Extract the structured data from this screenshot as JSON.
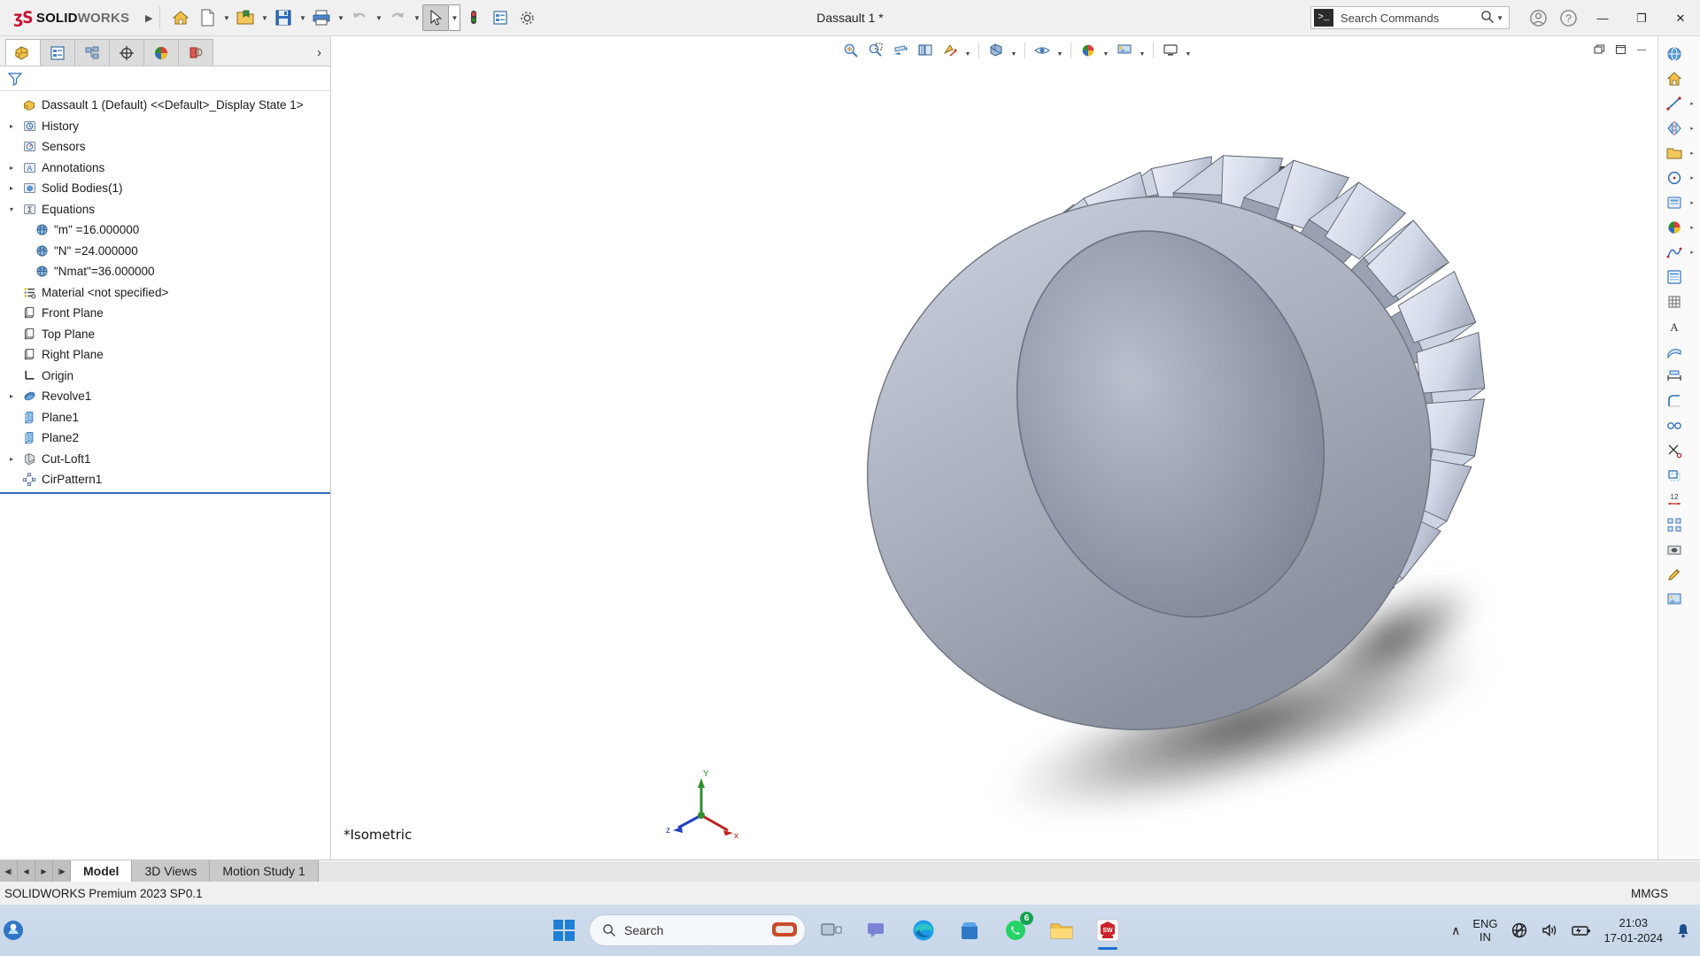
{
  "app": {
    "brand_ds": "ʒS",
    "brand_solid": "SOLID",
    "brand_works": "WORKS",
    "title": "Dassault 1 *",
    "accent_red": "#c8102e"
  },
  "titlebar": {
    "menu_arrow": "▶",
    "buttons": [
      {
        "name": "home-button",
        "icon": "home-icon"
      },
      {
        "name": "new-document-button",
        "icon": "new-file-icon"
      },
      {
        "name": "open-document-button",
        "icon": "open-folder-icon"
      },
      {
        "name": "save-button",
        "icon": "save-disk-icon"
      },
      {
        "name": "print-button",
        "icon": "printer-icon"
      },
      {
        "name": "undo-button",
        "icon": "undo-arrow-icon"
      },
      {
        "name": "redo-button",
        "icon": "redo-arrow-icon"
      },
      {
        "name": "select-button",
        "icon": "cursor-arrow-icon"
      },
      {
        "name": "rebuild-button",
        "icon": "traffic-light-icon"
      },
      {
        "name": "options-list-button",
        "icon": "list-properties-icon"
      },
      {
        "name": "settings-button",
        "icon": "gear-icon"
      }
    ],
    "search_placeholder": "Search Commands",
    "search_prompt_glyph": ">_",
    "window_min": "—",
    "window_max": "❐",
    "window_close": "✕"
  },
  "feature_manager": {
    "tabs": [
      {
        "name": "feature-manager-tab",
        "icon": "feature-tree-icon",
        "selected": true
      },
      {
        "name": "property-manager-tab",
        "icon": "property-list-icon",
        "selected": false
      },
      {
        "name": "configuration-manager-tab",
        "icon": "configuration-icon",
        "selected": false
      },
      {
        "name": "dimxpert-manager-tab",
        "icon": "dimxpert-target-icon",
        "selected": false
      },
      {
        "name": "display-manager-tab",
        "icon": "color-sphere-icon",
        "selected": false
      },
      {
        "name": "simulation-tab",
        "icon": "simulation-study-icon",
        "selected": false
      }
    ],
    "expand_glyph": "›",
    "filter_icon": "filter-funnel-icon"
  },
  "tree": {
    "root": {
      "label": "Dassault 1 (Default) <<Default>_Display State 1>",
      "icon": "part-document-icon"
    },
    "items": [
      {
        "label": "History",
        "icon": "history-icon",
        "indent": 0,
        "twisty": "▸"
      },
      {
        "label": "Sensors",
        "icon": "sensors-icon",
        "indent": 0,
        "twisty": ""
      },
      {
        "label": "Annotations",
        "icon": "annotations-icon",
        "indent": 0,
        "twisty": "▸"
      },
      {
        "label": "Solid Bodies(1)",
        "icon": "solid-bodies-icon",
        "indent": 0,
        "twisty": "▸"
      },
      {
        "label": "Equations",
        "icon": "equations-sigma-icon",
        "indent": 0,
        "twisty": "▾"
      },
      {
        "label": "\"m\" =16.000000",
        "icon": "global-variable-icon",
        "indent": 1,
        "twisty": ""
      },
      {
        "label": "\"N\" =24.000000",
        "icon": "global-variable-icon",
        "indent": 1,
        "twisty": ""
      },
      {
        "label": "\"Nmat\"=36.000000",
        "icon": "global-variable-icon",
        "indent": 1,
        "twisty": ""
      },
      {
        "label": "Material <not specified>",
        "icon": "material-icon",
        "indent": 0,
        "twisty": ""
      },
      {
        "label": "Front Plane",
        "icon": "plane-icon",
        "indent": 0,
        "twisty": ""
      },
      {
        "label": "Top Plane",
        "icon": "plane-icon",
        "indent": 0,
        "twisty": ""
      },
      {
        "label": "Right Plane",
        "icon": "plane-icon",
        "indent": 0,
        "twisty": ""
      },
      {
        "label": "Origin",
        "icon": "origin-icon",
        "indent": 0,
        "twisty": ""
      },
      {
        "label": "Revolve1",
        "icon": "revolve-feature-icon",
        "indent": 0,
        "twisty": "▸"
      },
      {
        "label": "Plane1",
        "icon": "reference-plane-icon",
        "indent": 0,
        "twisty": ""
      },
      {
        "label": "Plane2",
        "icon": "reference-plane-icon",
        "indent": 0,
        "twisty": ""
      },
      {
        "label": "Cut-Loft1",
        "icon": "cut-loft-icon",
        "indent": 0,
        "twisty": "▸"
      },
      {
        "label": "CirPattern1",
        "icon": "circular-pattern-icon",
        "indent": 0,
        "twisty": ""
      }
    ]
  },
  "hud_toolbar": {
    "buttons": [
      {
        "name": "zoom-to-fit-button",
        "icon": "zoom-fit-icon",
        "caret": false
      },
      {
        "name": "zoom-to-area-button",
        "icon": "zoom-area-icon",
        "caret": false
      },
      {
        "name": "previous-view-button",
        "icon": "previous-view-icon",
        "caret": false
      },
      {
        "name": "section-view-button",
        "icon": "section-view-icon",
        "caret": false
      },
      {
        "name": "view-orientation-button",
        "icon": "view-orientation-icon",
        "caret": true
      },
      {
        "name": "display-style-button",
        "icon": "display-style-icon",
        "caret": true
      },
      {
        "name": "hide-show-items-button",
        "icon": "hide-show-eye-icon",
        "caret": true
      },
      {
        "name": "edit-appearance-button",
        "icon": "appearance-sphere-icon",
        "caret": true
      },
      {
        "name": "apply-scene-button",
        "icon": "scene-backdrop-icon",
        "caret": true
      }
    ]
  },
  "document_window": {
    "restore_icon": "restore-window-icon",
    "maximize_icon": "maximize-window-icon",
    "minimize_glyph": "—",
    "maximize_glyph": "❐",
    "close_glyph": "✕"
  },
  "viewport": {
    "view_label": "*Isometric",
    "triad": {
      "x": "x",
      "y": "Y",
      "z": "z"
    },
    "model_name": "spur-gear-model"
  },
  "right_toolbar": {
    "items": [
      {
        "name": "view-globe-button",
        "icon": "globe-view-icon",
        "caret": false
      },
      {
        "name": "home-view-button",
        "icon": "home-view-icon",
        "caret": false
      },
      {
        "name": "line-tool-button",
        "icon": "line-icon",
        "caret": true
      },
      {
        "name": "mirror-tool-button",
        "icon": "mirror-icon",
        "caret": true
      },
      {
        "name": "open-view-button",
        "icon": "open-folder-small-icon",
        "caret": true
      },
      {
        "name": "circle-tool-button",
        "icon": "circle-icon",
        "caret": true
      },
      {
        "name": "display-state-button",
        "icon": "display-state-icon",
        "caret": true
      },
      {
        "name": "appearance-button",
        "icon": "appearance-ball-icon",
        "caret": true
      },
      {
        "name": "spline-tool-button",
        "icon": "spline-curve-icon",
        "caret": true
      },
      {
        "name": "task-pane-button",
        "icon": "task-pane-icon",
        "caret": false
      },
      {
        "name": "grid-tool-button",
        "icon": "grid-icon",
        "caret": false
      },
      {
        "name": "note-tool-button",
        "icon": "note-a-icon",
        "caret": false
      },
      {
        "name": "surface-tool-button",
        "icon": "surface-icon",
        "caret": false
      },
      {
        "name": "measure-tool-button",
        "icon": "measure-icon",
        "caret": false
      },
      {
        "name": "fillet-tool-button",
        "icon": "fillet-icon",
        "caret": false
      },
      {
        "name": "relation-tool-button",
        "icon": "relation-icon",
        "caret": false
      },
      {
        "name": "trim-tool-button",
        "icon": "trim-icon",
        "caret": false
      },
      {
        "name": "offset-tool-button",
        "icon": "offset-icon",
        "caret": false
      },
      {
        "name": "dimension-tool-button",
        "icon": "dimension-icon",
        "caret": false
      },
      {
        "name": "pattern-tool-button",
        "icon": "pattern-icon",
        "caret": false
      },
      {
        "name": "hole-tool-button",
        "icon": "hole-wizard-icon",
        "caret": false
      },
      {
        "name": "edit-sketch-button",
        "icon": "edit-pencil-icon",
        "caret": false
      },
      {
        "name": "sketch-picture-button",
        "icon": "sketch-picture-icon",
        "caret": false
      }
    ]
  },
  "document_tabs": {
    "nav": [
      "◀❘",
      "◀",
      "▶",
      "❘▶"
    ],
    "tabs": [
      {
        "label": "Model",
        "selected": true
      },
      {
        "label": "3D Views",
        "selected": false
      },
      {
        "label": "Motion Study 1",
        "selected": false
      }
    ]
  },
  "statusbar": {
    "left": "SOLIDWORKS Premium 2023 SP0.1",
    "units": "MMGS"
  },
  "taskbar": {
    "start_name": "windows-start-button",
    "search_label": "Search",
    "apps": [
      {
        "name": "taskview-button",
        "icon": "task-view-icon",
        "badge": null,
        "active": false
      },
      {
        "name": "teams-button",
        "icon": "teams-chat-icon",
        "badge": null,
        "active": false
      },
      {
        "name": "edge-button",
        "icon": "edge-browser-icon",
        "badge": null,
        "active": false
      },
      {
        "name": "store-button",
        "icon": "microsoft-store-icon",
        "badge": null,
        "active": false
      },
      {
        "name": "whatsapp-button",
        "icon": "whatsapp-icon",
        "badge": "6",
        "active": false
      },
      {
        "name": "file-explorer-button",
        "icon": "file-explorer-icon",
        "badge": null,
        "active": false
      },
      {
        "name": "solidworks-taskbar-button",
        "icon": "solidworks-app-icon",
        "badge": null,
        "active": true
      }
    ],
    "tray": {
      "chevron": "∧",
      "lang_line1": "ENG",
      "lang_line2": "IN",
      "network_icon": "network-offline-icon",
      "volume_icon": "speaker-icon",
      "battery_icon": "battery-charging-icon",
      "time": "21:03",
      "date": "17-01-2024",
      "notification_icon": "bell-icon"
    }
  }
}
